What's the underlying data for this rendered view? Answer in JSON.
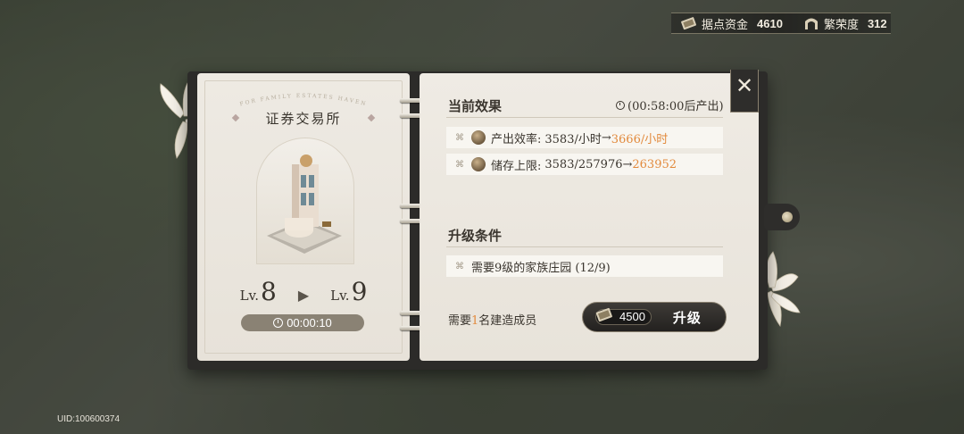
{
  "resources": {
    "funds_label": "据点资金",
    "funds_value": "4610",
    "prosperity_label": "繁荣度",
    "prosperity_value": "312"
  },
  "building": {
    "arc_text": "FOR FAMILY ESTATES HAVEN",
    "name": "证券交易所",
    "level_prefix": "Lv.",
    "current_level": "8",
    "next_level": "9",
    "upgrade_time": "00:00:10"
  },
  "effects": {
    "title": "当前效果",
    "timer_note": "(00:58:00后产出)",
    "rows": [
      {
        "label": "产出效率:",
        "current": "3583/小时",
        "arrow": "→",
        "next": "3666/小时"
      },
      {
        "label": "储存上限:",
        "current": "3583/257976",
        "arrow": "→",
        "next": "263952"
      }
    ]
  },
  "conditions": {
    "title": "升级条件",
    "rows": [
      {
        "text": "需要9级的家族庄园 (12/9)"
      }
    ]
  },
  "builders": {
    "prefix": "需要",
    "count": "1",
    "suffix": "名建造成员"
  },
  "upgrade_button": {
    "cost": "4500",
    "label": "升级"
  },
  "close_icon": "close-icon",
  "uid": "UID:100600374",
  "colors": {
    "highlight": "#e28a3d",
    "page": "#efebe4",
    "binder": "#2c2b29"
  }
}
